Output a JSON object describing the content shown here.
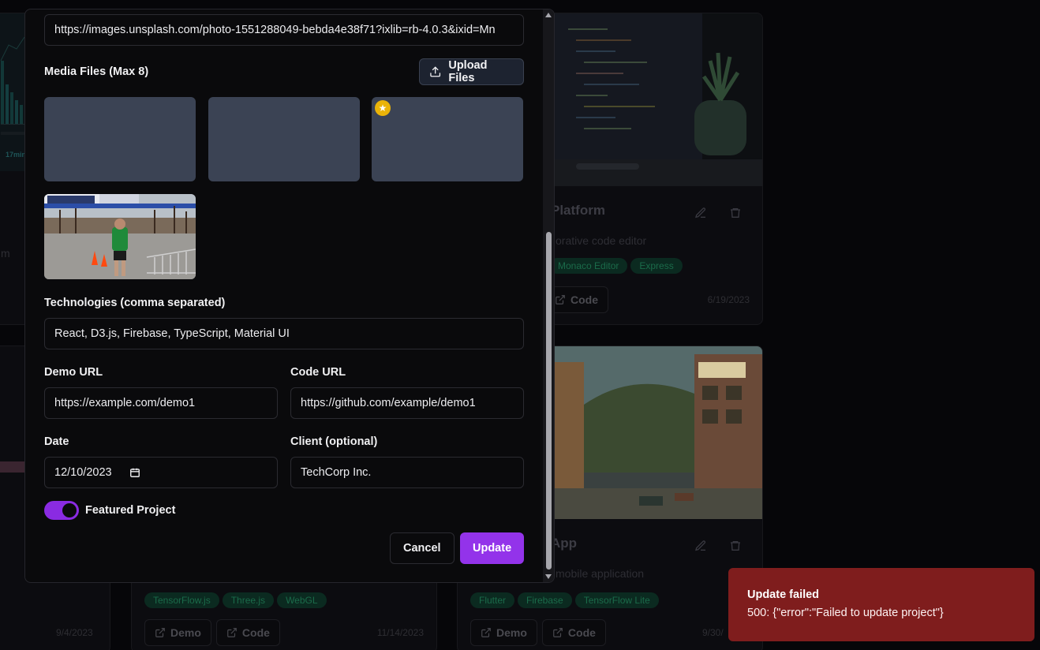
{
  "modal": {
    "image_url_value": "https://images.unsplash.com/photo-1551288049-bebda4e38f71?ixlib=rb-4.0.3&ixid=Mn",
    "media_label": "Media Files (Max 8)",
    "upload_label": "Upload Files",
    "technologies_label": "Technologies (comma separated)",
    "technologies_value": "React, D3.js, Firebase, TypeScript, Material UI",
    "demo_url_label": "Demo URL",
    "demo_url_value": "https://example.com/demo1",
    "code_url_label": "Code URL",
    "code_url_value": "https://github.com/example/demo1",
    "date_label": "Date",
    "date_value": "12/10/2023",
    "client_label": "Client (optional)",
    "client_value": "TechCorp Inc.",
    "featured_label": "Featured Project",
    "featured_on": true,
    "cancel_label": "Cancel",
    "update_label": "Update"
  },
  "toast": {
    "title": "Update failed",
    "message": "500: {\"error\":\"Failed to update project\"}"
  },
  "background": {
    "card1": {
      "title": "Platform",
      "desc": "orative code editor",
      "tags": [
        "Monaco Editor",
        "Express"
      ],
      "code_label": "Code",
      "date": "6/19/2023"
    },
    "card2": {
      "title": "App",
      "desc": "mobile application",
      "tags": [
        "Flutter",
        "Firebase",
        "TensorFlow Lite"
      ],
      "demo_label": "Demo",
      "code_label": "Code",
      "date": "9/30/"
    },
    "card3": {
      "tags": [
        "TensorFlow.js",
        "Three.js",
        "WebGL"
      ],
      "demo_label": "Demo",
      "code_label": "Code",
      "date": "11/14/2023"
    },
    "left_date": "9/4/2023",
    "left_stat": "17min",
    "left_letter": "m"
  }
}
